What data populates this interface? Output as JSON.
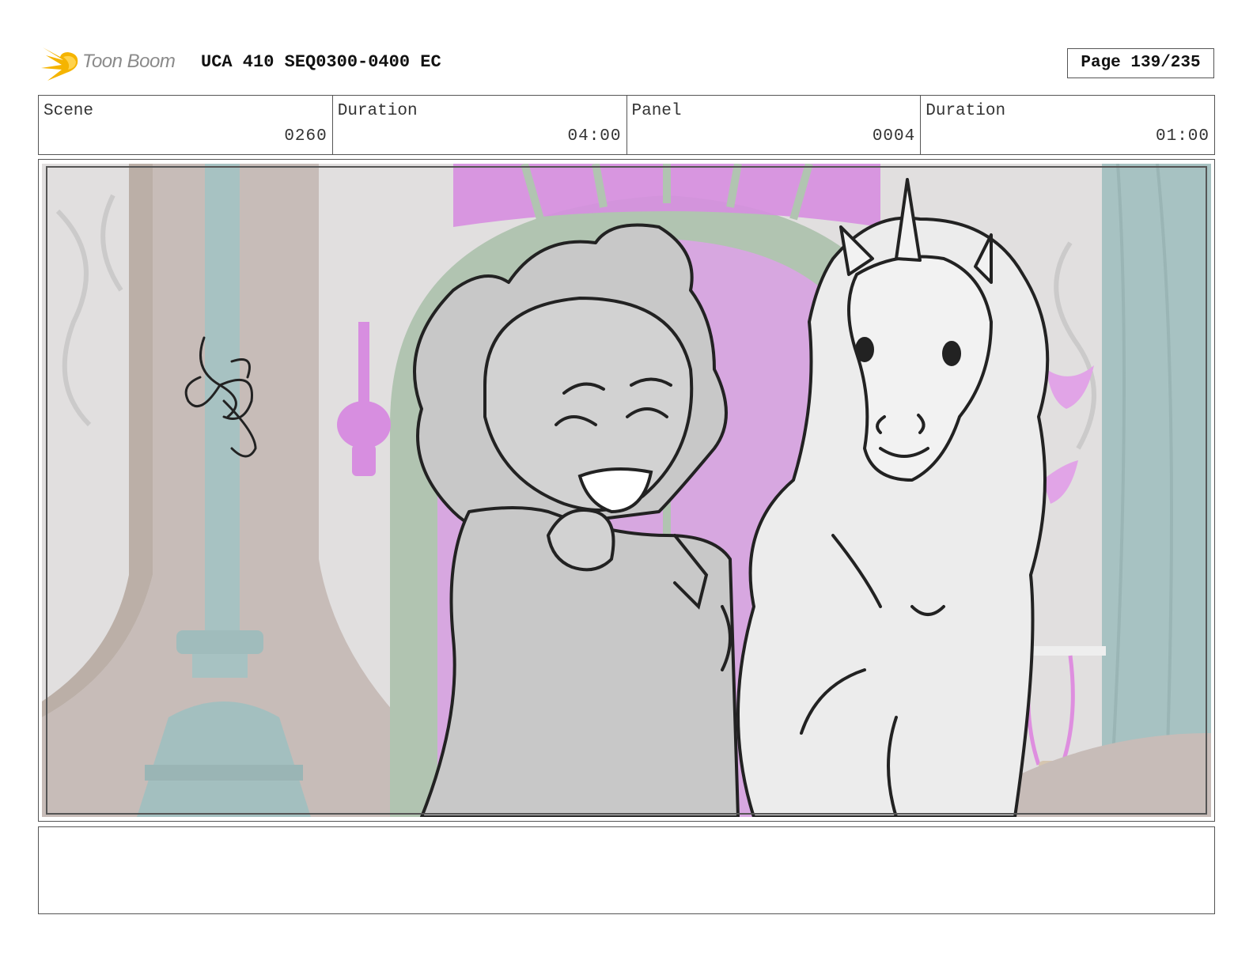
{
  "header": {
    "logo_text": "Toon Boom",
    "title": "UCA 410 SEQ0300-0400 EC",
    "page": "Page 139/235"
  },
  "info": {
    "scene_label": "Scene",
    "scene_value": "0260",
    "scene_duration_label": "Duration",
    "scene_duration_value": "04:00",
    "panel_label": "Panel",
    "panel_value": "0004",
    "panel_duration_label": "Duration",
    "panel_duration_value": "01:00"
  },
  "notes": {
    "text": ""
  },
  "colors": {
    "logo_flame": "#f5b400",
    "accent_magenta": "#cc6fd8",
    "wall_teal": "#8fb1b1",
    "arch_green": "#9cb49c"
  }
}
